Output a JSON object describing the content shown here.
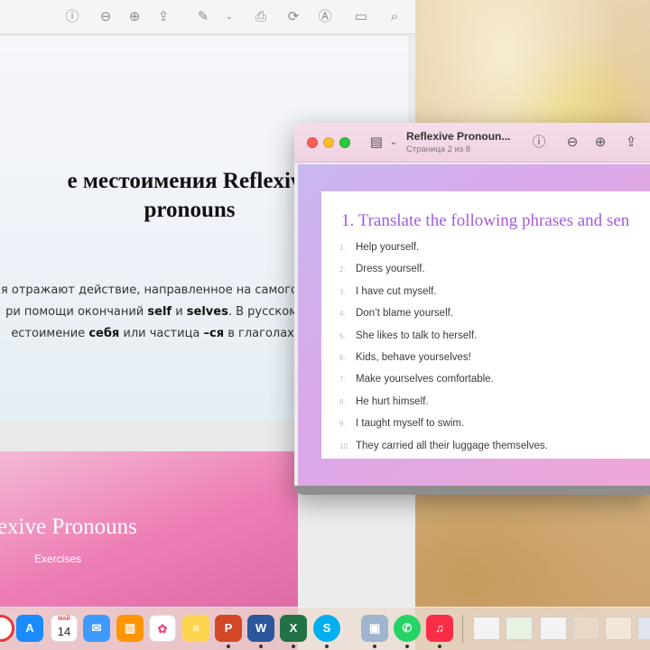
{
  "window_back": {
    "slide1": {
      "title_line1": "е местоимения Reflexive",
      "title_line2": "pronouns",
      "text_line1": "ия отражают действие, направленное на самого",
      "text_line2_a": "ри помощи окончаний ",
      "text_line2_b": "self",
      "text_line2_c": " и ",
      "text_line2_d": "selves",
      "text_line2_e": ". В русском",
      "text_line3_a": "естоимение ",
      "text_line3_b": "себя",
      "text_line3_c": " или частица ",
      "text_line3_d": "–ся",
      "text_line3_e": " в глаголах."
    },
    "slide2": {
      "title": "lexive Pronouns",
      "subtitle": "Exercises"
    }
  },
  "window_front": {
    "title": "Reflexive Pronoun...",
    "subtitle": "Страница 2 из 8",
    "heading": "1. Translate the following phrases and sen",
    "items": [
      {
        "num": "1.",
        "text": "Help yourself."
      },
      {
        "num": "2.",
        "text": "Dress yourself."
      },
      {
        "num": "3.",
        "text": "I have cut myself."
      },
      {
        "num": "4.",
        "text": "Don’t blame yourself."
      },
      {
        "num": "5.",
        "text": "She likes to talk to herself."
      },
      {
        "num": "6.",
        "text": "Kids, behave yourselves!"
      },
      {
        "num": "7.",
        "text": "Make yourselves comfortable."
      },
      {
        "num": "8.",
        "text": "He hurt himself."
      },
      {
        "num": "9.",
        "text": "I taught myself to swim."
      },
      {
        "num": "10.",
        "text": "They carried all their luggage themselves."
      }
    ]
  },
  "dock": {
    "calendar_month": "МАЙ",
    "calendar_day": "14",
    "apps": [
      "chrome",
      "app-store",
      "calendar",
      "mail",
      "books",
      "photos",
      "notes",
      "powerpoint",
      "word",
      "excel",
      "skype",
      "preview",
      "whatsapp",
      "music"
    ]
  },
  "colors": {
    "accent_heading": "#a55bdc",
    "traffic_red": "#ff5f57",
    "traffic_yellow": "#febc2e",
    "traffic_green": "#28c840"
  }
}
